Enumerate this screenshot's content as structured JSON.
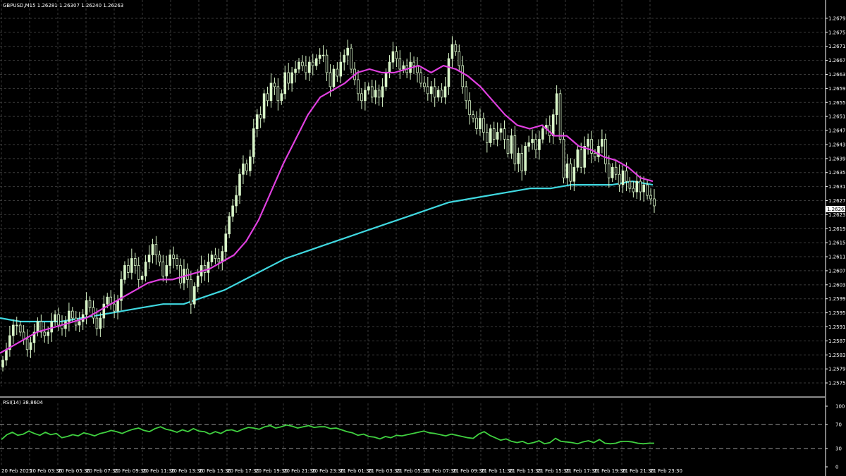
{
  "header": {
    "symbol_info": "GBPUSD,M15  1.26281 1.26307 1.26240 1.26263"
  },
  "price_tag": "1.26263",
  "rsi_header": "RSI(14) 38.8604",
  "colors": {
    "background": "#000000",
    "grid": "#3a3a3a",
    "candle": "#d8f5c8",
    "ma_fast": "#e040e0",
    "ma_slow": "#40d8e0",
    "rsi": "#40d040",
    "price_tag_bg": "#ffffff",
    "text": "#ffffff"
  },
  "chart_data": [
    {
      "type": "candlestick",
      "symbol": "GBPUSD",
      "timeframe": "M15",
      "y_ticks": [
        "1.26795",
        "1.26755",
        "1.26715",
        "1.26675",
        "1.26635",
        "1.26595",
        "1.26555",
        "1.26515",
        "1.26475",
        "1.26435",
        "1.26395",
        "1.26355",
        "1.26315",
        "1.26275",
        "1.26235",
        "1.26195",
        "1.26155",
        "1.26115",
        "1.26075",
        "1.26035",
        "1.25995",
        "1.25955",
        "1.25915",
        "1.25875",
        "1.25835",
        "1.25795",
        "1.25755"
      ],
      "ylim": [
        1.25745,
        1.26815
      ],
      "x_ticks": [
        "20 Feb 2025",
        "20 Feb 03:30",
        "20 Feb 05:30",
        "20 Feb 07:30",
        "20 Feb 09:30",
        "20 Feb 11:30",
        "20 Feb 13:30",
        "20 Feb 15:30",
        "20 Feb 17:30",
        "20 Feb 19:30",
        "20 Feb 21:30",
        "20 Feb 23:30",
        "21 Feb 01:30",
        "21 Feb 03:30",
        "21 Feb 05:30",
        "21 Feb 07:30",
        "21 Feb 09:30",
        "21 Feb 11:30",
        "21 Feb 13:30",
        "21 Feb 15:30",
        "21 Feb 17:30",
        "21 Feb 19:30",
        "21 Feb 21:30",
        "21 Feb 23:30"
      ],
      "series": [
        {
          "kind": "close",
          "values": [
            1.2582,
            1.2585,
            1.2589,
            1.2592,
            1.2592,
            1.259,
            1.2588,
            1.2585,
            1.2587,
            1.259,
            1.2593,
            1.259,
            1.2589,
            1.259,
            1.2593,
            1.2595,
            1.2592,
            1.2591,
            1.2593,
            1.2596,
            1.2594,
            1.2592,
            1.2593,
            1.2595,
            1.2599,
            1.2597,
            1.2594,
            1.2591,
            1.2594,
            1.2598,
            1.26,
            1.2598,
            1.2596,
            1.2599,
            1.2605,
            1.2609,
            1.2607,
            1.2611,
            1.2609,
            1.2605,
            1.2606,
            1.261,
            1.2612,
            1.2615,
            1.2612,
            1.261,
            1.2606,
            1.2609,
            1.2612,
            1.2611,
            1.2609,
            1.2604,
            1.2608,
            1.2605,
            1.2598,
            1.2603,
            1.2606,
            1.2609,
            1.2607,
            1.261,
            1.2612,
            1.2611,
            1.261,
            1.2613,
            1.2618,
            1.2623,
            1.2626,
            1.2629,
            1.2635,
            1.2638,
            1.2636,
            1.264,
            1.2648,
            1.2652,
            1.2651,
            1.2658,
            1.2656,
            1.2661,
            1.266,
            1.2656,
            1.2658,
            1.2664,
            1.2661,
            1.2664,
            1.2665,
            1.2667,
            1.2666,
            1.2664,
            1.2667,
            1.2666,
            1.2668,
            1.2669,
            1.2669,
            1.2664,
            1.266,
            1.2665,
            1.2663,
            1.2667,
            1.2669,
            1.2671,
            1.2665,
            1.2662,
            1.2658,
            1.2656,
            1.2659,
            1.266,
            1.2657,
            1.2659,
            1.2657,
            1.266,
            1.2664,
            1.2667,
            1.267,
            1.2668,
            1.2665,
            1.2666,
            1.2664,
            1.2667,
            1.2666,
            1.2664,
            1.2661,
            1.266,
            1.2658,
            1.266,
            1.2657,
            1.2659,
            1.2657,
            1.266,
            1.2668,
            1.2672,
            1.267,
            1.2666,
            1.266,
            1.2656,
            1.2652,
            1.2651,
            1.2648,
            1.2651,
            1.2647,
            1.2644,
            1.2648,
            1.2645,
            1.2647,
            1.2648,
            1.2645,
            1.2641,
            1.2646,
            1.2638,
            1.2641,
            1.2636,
            1.2643,
            1.2644,
            1.2645,
            1.2642,
            1.2645,
            1.2648,
            1.2649,
            1.2646,
            1.2652,
            1.2658,
            1.2645,
            1.2634,
            1.2638,
            1.2633,
            1.2637,
            1.2642,
            1.2637,
            1.2643,
            1.2645,
            1.2641,
            1.264,
            1.2643,
            1.2645,
            1.2638,
            1.2634,
            1.2637,
            1.2635,
            1.2632,
            1.2636,
            1.2633,
            1.2631,
            1.263,
            1.2633,
            1.263,
            1.2632,
            1.2629,
            1.2628,
            1.2626
          ]
        },
        {
          "name": "",
          "kind": "ma_fast",
          "values": [
            1.2584,
            1.2586,
            1.2588,
            1.259,
            1.2591,
            1.2592,
            1.2593,
            1.2594,
            1.2596,
            1.2598,
            1.26,
            1.2602,
            1.2604,
            1.2605,
            1.2605,
            1.2606,
            1.2607,
            1.2608,
            1.261,
            1.2612,
            1.2616,
            1.2622,
            1.263,
            1.2638,
            1.2645,
            1.2652,
            1.2657,
            1.2659,
            1.2661,
            1.2664,
            1.2665,
            1.2664,
            1.2664,
            1.2665,
            1.2666,
            1.2664,
            1.2666,
            1.2665,
            1.2663,
            1.266,
            1.2656,
            1.2652,
            1.2649,
            1.2648,
            1.2649,
            1.2646,
            1.2646,
            1.2643,
            1.2642,
            1.264,
            1.2639,
            1.2637,
            1.2634,
            1.2633
          ]
        },
        {
          "name": "",
          "kind": "ma_slow",
          "values": [
            1.2594,
            1.2593,
            1.2593,
            1.2593,
            1.2594,
            1.2595,
            1.2596,
            1.2597,
            1.2598,
            1.2598,
            1.26,
            1.2602,
            1.2605,
            1.2608,
            1.2611,
            1.2613,
            1.2615,
            1.2617,
            1.2619,
            1.2621,
            1.2623,
            1.2625,
            1.2627,
            1.2628,
            1.2629,
            1.263,
            1.2631,
            1.2631,
            1.2632,
            1.2632,
            1.2632,
            1.2633,
            1.2632
          ]
        }
      ]
    },
    {
      "type": "line",
      "indicator": "RSI(14)",
      "y_ticks": [
        "100",
        "70",
        "30",
        "0"
      ],
      "levels": [
        70,
        30
      ],
      "ylim": [
        0,
        100
      ],
      "values": [
        45,
        53,
        57,
        52,
        54,
        59,
        55,
        52,
        57,
        53,
        55,
        48,
        50,
        53,
        51,
        56,
        54,
        51,
        55,
        57,
        60,
        58,
        55,
        59,
        62,
        64,
        60,
        58,
        63,
        66,
        62,
        60,
        57,
        61,
        58,
        63,
        59,
        58,
        54,
        58,
        55,
        60,
        61,
        58,
        62,
        65,
        64,
        62,
        66,
        68,
        64,
        66,
        69,
        67,
        64,
        66,
        68,
        65,
        66,
        66,
        63,
        64,
        61,
        58,
        56,
        52,
        54,
        50,
        49,
        46,
        50,
        48,
        52,
        51,
        53,
        55,
        57,
        59,
        56,
        55,
        53,
        51,
        54,
        52,
        50,
        48,
        47,
        54,
        58,
        52,
        48,
        44,
        46,
        42,
        40,
        42,
        38,
        40,
        43,
        38,
        40,
        47,
        42,
        41,
        40,
        38,
        41,
        43,
        40,
        45,
        39,
        38,
        39,
        42,
        42,
        41,
        39,
        38,
        39,
        39
      ]
    }
  ]
}
